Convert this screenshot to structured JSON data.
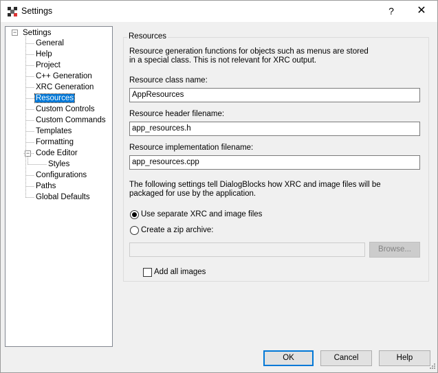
{
  "window": {
    "title": "Settings",
    "help_glyph": "?",
    "close_glyph": "✕"
  },
  "tree": {
    "root": "Settings",
    "items": [
      {
        "label": "General"
      },
      {
        "label": "Help"
      },
      {
        "label": "Project"
      },
      {
        "label": "C++ Generation"
      },
      {
        "label": "XRC Generation"
      },
      {
        "label": "Resources",
        "selected": true
      },
      {
        "label": "Custom Controls"
      },
      {
        "label": "Custom Commands"
      },
      {
        "label": "Templates"
      },
      {
        "label": "Formatting"
      },
      {
        "label": "Code Editor"
      },
      {
        "label": "Styles"
      },
      {
        "label": "Configurations"
      },
      {
        "label": "Paths"
      },
      {
        "label": "Global Defaults"
      }
    ]
  },
  "panel": {
    "group_title": "Resources",
    "description_line1": "Resource generation functions for objects such as menus are stored",
    "description_line2": "in a special class. This is not relevant for XRC output.",
    "class_name_label": "Resource class name:",
    "class_name_value": "AppResources",
    "header_label": "Resource header filename:",
    "header_value": "app_resources.h",
    "impl_label": "Resource implementation filename:",
    "impl_value": "app_resources.cpp",
    "settings_line1": "The following settings tell DialogBlocks how XRC and image files will be",
    "settings_line2": "packaged for use by the application.",
    "radio_separate": "Use separate XRC and image files",
    "radio_zip": "Create a zip archive:",
    "zip_value": "",
    "browse_label": "Browse...",
    "add_images_label": "Add all images"
  },
  "footer": {
    "ok": "OK",
    "cancel": "Cancel",
    "help": "Help"
  }
}
